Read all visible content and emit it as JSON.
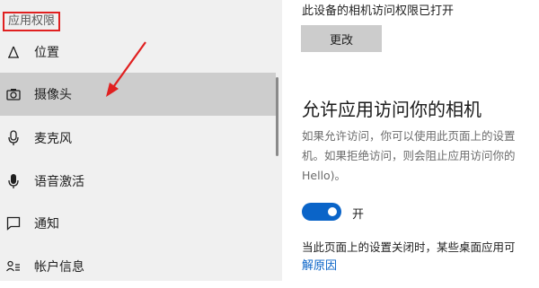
{
  "sidebar": {
    "section_label": "应用权限",
    "items": [
      {
        "label": "位置",
        "icon": "location-icon"
      },
      {
        "label": "摄像头",
        "icon": "camera-icon",
        "selected": true
      },
      {
        "label": "麦克风",
        "icon": "microphone-icon"
      },
      {
        "label": "语音激活",
        "icon": "voice-activation-icon"
      },
      {
        "label": "通知",
        "icon": "notification-icon"
      },
      {
        "label": "帐户信息",
        "icon": "account-info-icon"
      }
    ]
  },
  "main": {
    "status_text": "此设备的相机访问权限已打开",
    "change_button": "更改",
    "heading": "允许应用访问你的相机",
    "description_lines": [
      "如果允许访问，你可以使用此页面上的设置",
      "机。如果拒绝访问，则会阻止应用访问你的",
      "Hello)。"
    ],
    "toggle_label": "开",
    "toggle_on": true,
    "note_text": "当此页面上的设置关闭时，某些桌面应用可",
    "learn_more_link": "解原因"
  },
  "colors": {
    "accent": "#0a64c8",
    "annotation_red": "#e02020",
    "sidebar_bg": "#f0f0f0",
    "selected_bg": "#cdcdcd"
  }
}
